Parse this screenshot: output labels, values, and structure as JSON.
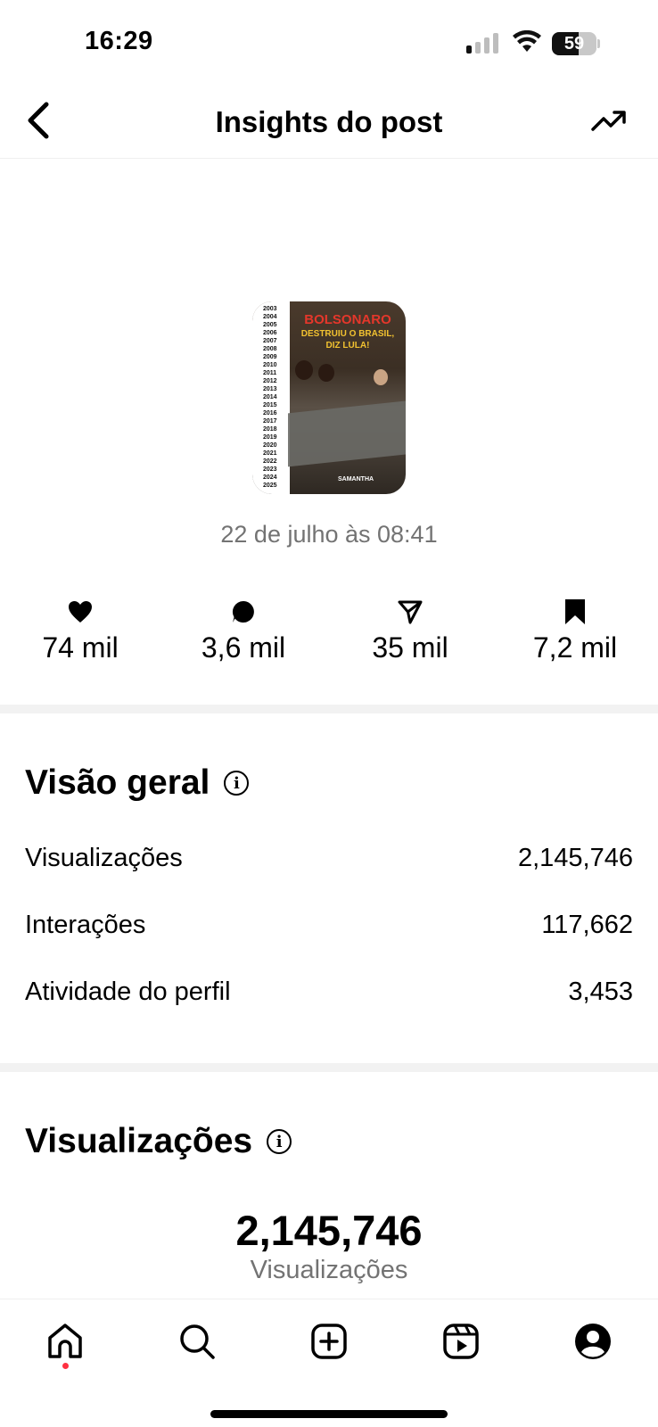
{
  "status_bar": {
    "time": "16:29",
    "battery": "59",
    "battery_level": 0.59,
    "icons": [
      "cellular-signal-icon",
      "wifi-icon",
      "battery-icon"
    ]
  },
  "header": {
    "title": "Insights do post",
    "back_icon": "chevron-left-icon",
    "trend_icon": "trending-up-icon"
  },
  "post": {
    "thumbnail": {
      "years": [
        "2003",
        "2004",
        "2005",
        "2006",
        "2007",
        "2008",
        "2009",
        "2010",
        "2011",
        "2012",
        "2013",
        "2014",
        "2015",
        "2016",
        "2017",
        "2018",
        "2019",
        "2020",
        "2021",
        "2022",
        "2023",
        "2024",
        "2025"
      ],
      "headline": "BOLSONARO",
      "subheadline": "DESTRUIU O BRASIL, DIZ LULA!",
      "brand": "SAMANTHA"
    },
    "date": "22 de julho às 08:41"
  },
  "stats": {
    "likes": "74 mil",
    "comments": "3,6 mil",
    "shares": "35 mil",
    "saves": "7,2 mil"
  },
  "overview": {
    "title": "Visão geral",
    "rows": [
      {
        "label": "Visualizações",
        "value": "2,145,746"
      },
      {
        "label": "Interações",
        "value": "117,662"
      },
      {
        "label": "Atividade do perfil",
        "value": "3,453"
      }
    ]
  },
  "views": {
    "title": "Visualizações",
    "total": "2,145,746",
    "label": "Visualizações"
  },
  "bottom_nav": {
    "items": [
      "home-icon",
      "search-icon",
      "create-icon",
      "reels-icon",
      "profile-icon"
    ],
    "notification_color": "#ff3040"
  }
}
